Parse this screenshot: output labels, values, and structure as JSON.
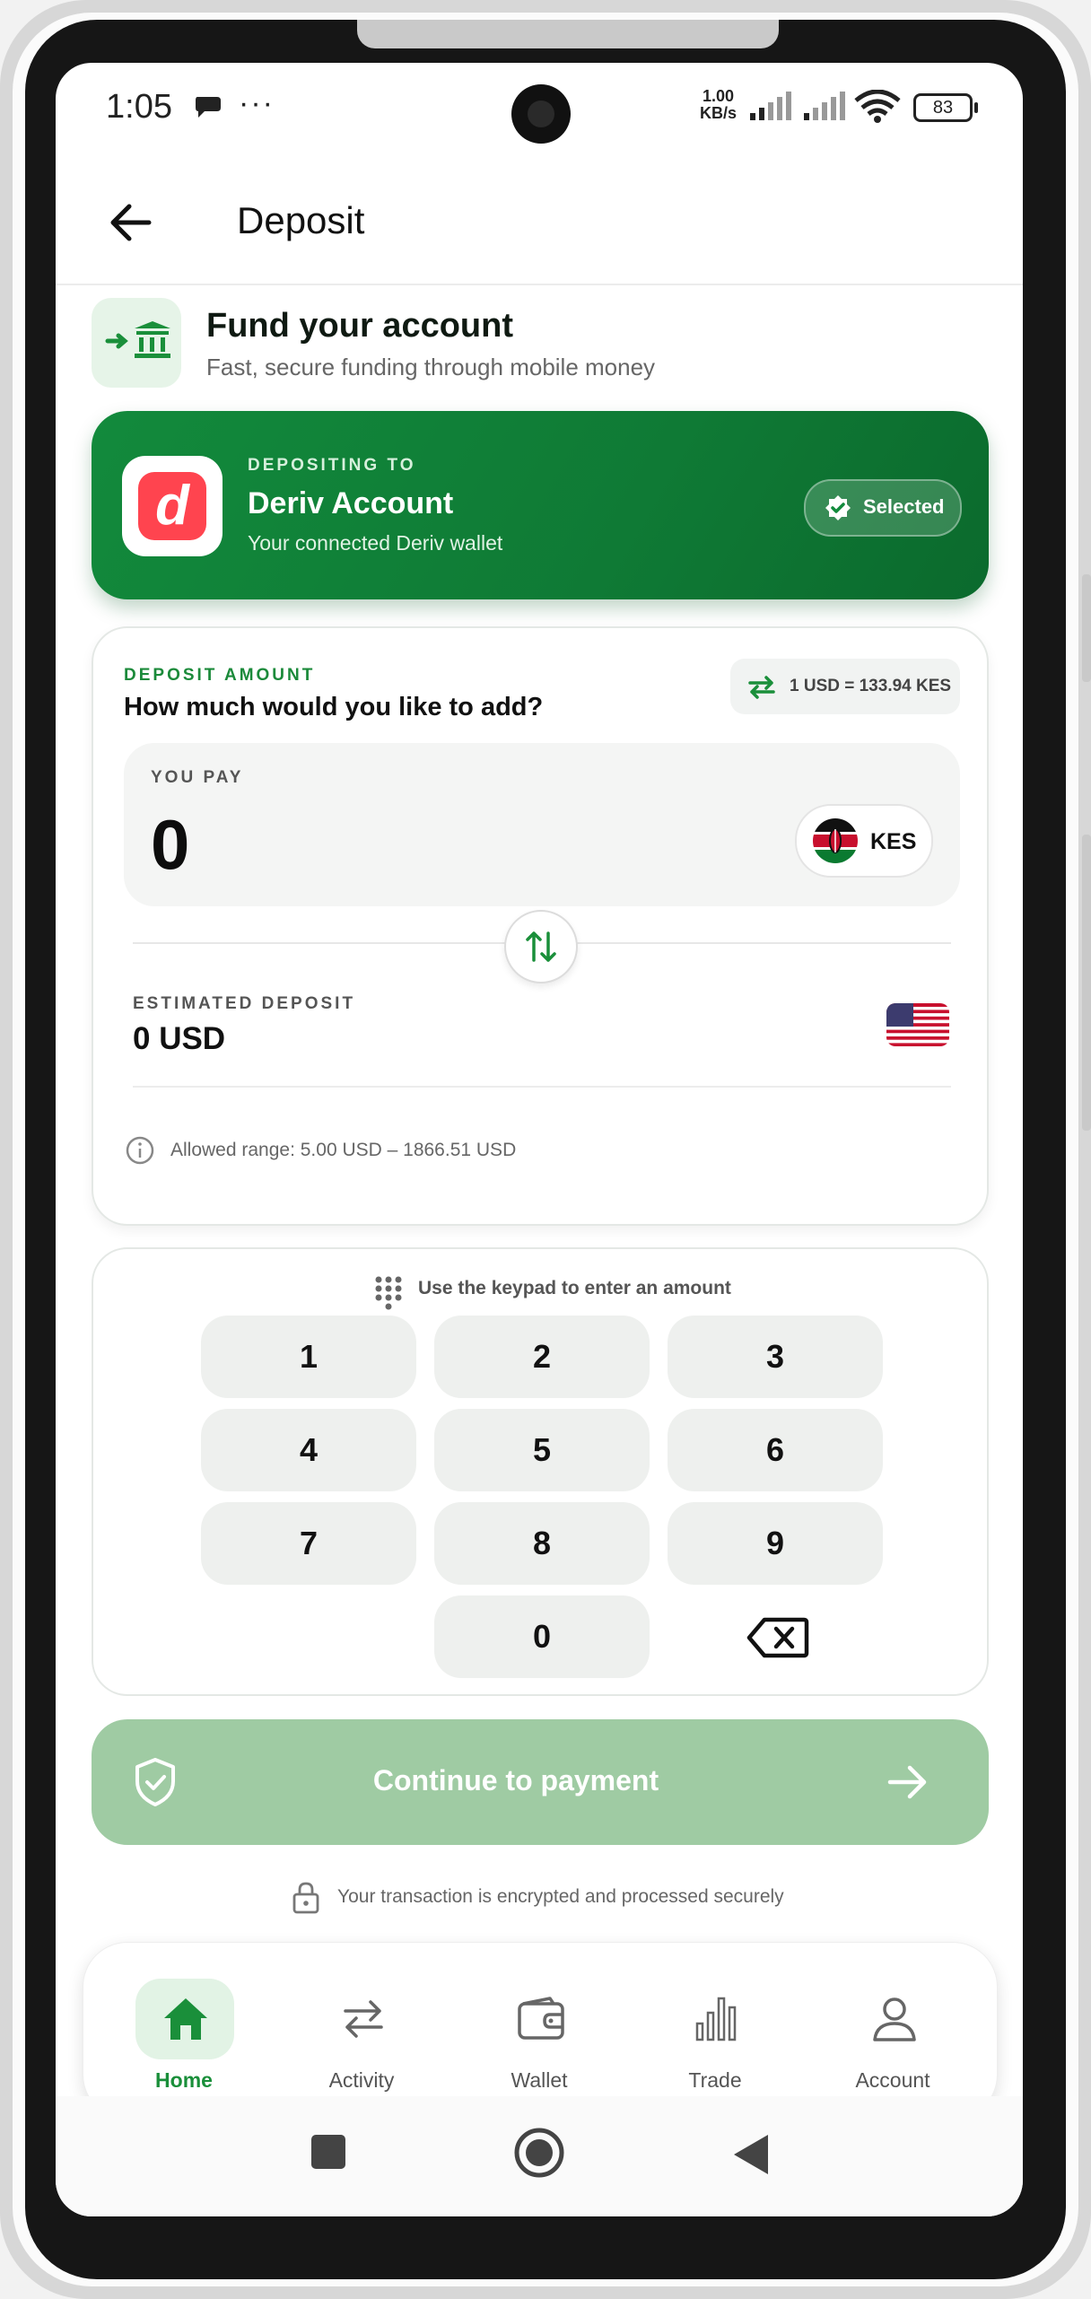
{
  "status_bar": {
    "time": "1:05",
    "more": "···",
    "net_speed_value": "1.00",
    "net_speed_unit": "KB/s",
    "battery": "83"
  },
  "header": {
    "title": "Deposit"
  },
  "fund": {
    "title": "Fund your account",
    "subtitle": "Fast, secure funding through mobile money"
  },
  "deposit_target": {
    "label": "DEPOSITING TO",
    "logo_letter": "d",
    "name": "Deriv Account",
    "subtitle": "Your connected Deriv wallet",
    "badge": "Selected"
  },
  "amount": {
    "label": "DEPOSIT AMOUNT",
    "question": "How much would you like to add?",
    "rate": "1 USD = 133.94 KES",
    "you_pay_label": "YOU PAY",
    "you_pay_value": "0",
    "pay_currency": "KES",
    "estimated_label": "ESTIMATED DEPOSIT",
    "estimated_value": "0 USD",
    "range": "Allowed range: 5.00 USD – 1866.51 USD"
  },
  "keypad": {
    "hint": "Use the keypad to enter an amount",
    "keys": [
      "1",
      "2",
      "3",
      "4",
      "5",
      "6",
      "7",
      "8",
      "9",
      "0"
    ]
  },
  "cta": {
    "label": "Continue to payment",
    "secure_note": "Your transaction is encrypted and processed securely"
  },
  "nav": {
    "items": [
      {
        "label": "Home",
        "active": true
      },
      {
        "label": "Activity"
      },
      {
        "label": "Wallet"
      },
      {
        "label": "Trade"
      },
      {
        "label": "Account"
      }
    ]
  },
  "colors": {
    "brand_green": "#128a3c",
    "cta_disabled": "#9fcba3",
    "deriv_red": "#ff444f"
  }
}
